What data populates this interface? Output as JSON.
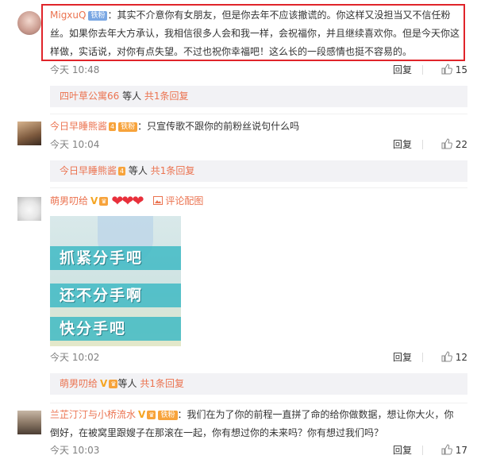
{
  "colors": {
    "accent": "#eb7350",
    "highlight_border": "#e0242a",
    "sub_bg": "#f2f2f5"
  },
  "comments": [
    {
      "user": "MigxuQ",
      "badge": "铁粉",
      "text": "：其实不介意你有女朋友，但是你去年不应该撤谎的。你这样又没担当又不信任粉丝。如果你去年大方承认，我相信很多人会和我一样，会祝福你，并且继续喜欢你。但是今天你这样做，实话说，对你有点失望。不过也祝你幸福吧！这么长的一段感情也挺不容易的。",
      "time": "今天 10:48",
      "reply_label": "回复",
      "likes": "15",
      "sub_user": "四叶草公寓66",
      "sub_mid": " 等人 ",
      "sub_count": "共1条回复"
    },
    {
      "user": "今日早睡熊酱",
      "level": "4",
      "badge": "铁粉",
      "text": "：只宣传歌不跟你的前粉丝说句什么吗",
      "time": "今天 10:04",
      "reply_label": "回复",
      "likes": "22",
      "sub_user": "今日早睡熊酱",
      "sub_mid": " 等人 ",
      "sub_count": "共1条回复"
    },
    {
      "user": "萌男叨给",
      "hearts": "❤❤❤",
      "pic_label": "评论配图",
      "image_lines": [
        "抓紧分手吧",
        "还不分手啊",
        "快分手吧"
      ],
      "time": "今天 10:02",
      "reply_label": "回复",
      "likes": "12",
      "sub_user": "萌男叨给",
      "sub_mid": "等人 ",
      "sub_count": "共1条回复"
    },
    {
      "user": "兰芷汀汀与小桥流水",
      "badge": "铁粉",
      "text": "：我们在为了你的前程一直拼了命的给你做数据，想让你大火，你倒好，在被窝里跟嫂子在那滚在一起，你有想过你的未来吗？你有想过我们吗？",
      "time": "今天 10:03",
      "reply_label": "回复",
      "likes": "17"
    }
  ]
}
